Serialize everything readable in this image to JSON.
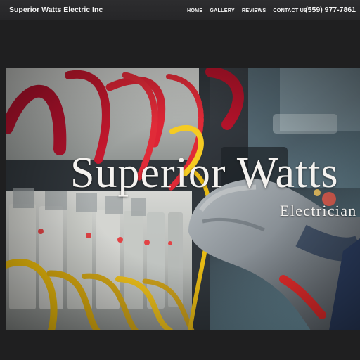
{
  "header": {
    "brand": "Superior Watts Electric Inc",
    "nav": [
      {
        "label": "HOME"
      },
      {
        "label": "GALLERY"
      },
      {
        "label": "REVIEWS"
      },
      {
        "label": "CONTACT US"
      }
    ],
    "phone": "(559) 977-7861"
  },
  "hero": {
    "title": "Superior Watts",
    "subtitle": "Electrician"
  },
  "colors": {
    "background": "#1f1f20",
    "header": "#2d2d2f",
    "text": "#f2f2f2",
    "wire_red": "#d92433",
    "wire_yellow": "#e9b914",
    "glove_gray": "#8f969b"
  }
}
